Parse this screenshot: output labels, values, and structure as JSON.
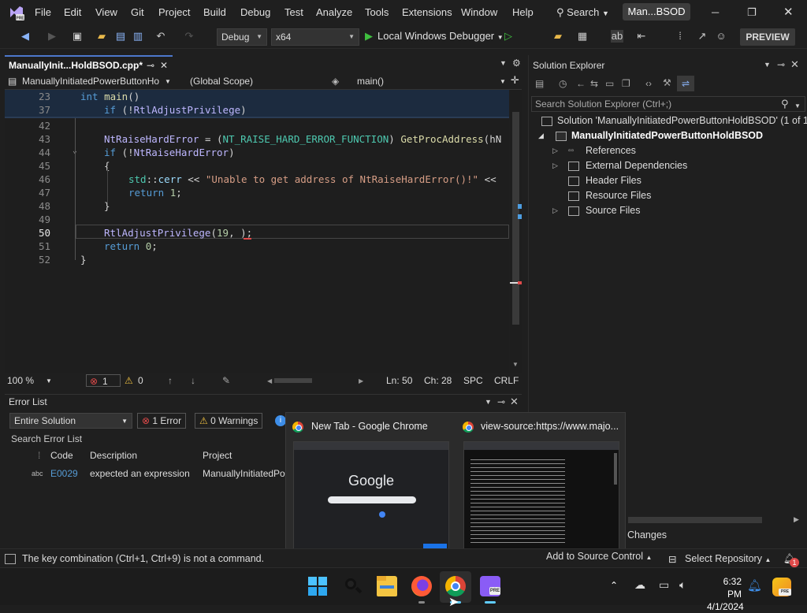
{
  "titlebar": {
    "menus": [
      "File",
      "Edit",
      "View",
      "Git",
      "Project",
      "Build",
      "Debug",
      "Test",
      "Analyze",
      "Tools",
      "Extensions",
      "Window",
      "Help"
    ],
    "search": "Search",
    "project": "Man...BSOD"
  },
  "toolbar": {
    "config": "Debug",
    "platform": "x64",
    "run": "Local Windows Debugger",
    "preview": "PREVIEW"
  },
  "editor": {
    "tab": "ManuallyInit...HoldBSOD.cpp*",
    "nav_file": "ManuallyInitiatedPowerButtonHo",
    "nav_scope": "(Global Scope)",
    "nav_func": "main()",
    "zoom": "100 %",
    "errors": "1",
    "warnings": "0",
    "ln": "Ln: 50",
    "ch": "Ch: 28",
    "spc": "SPC",
    "crlf": "CRLF"
  },
  "code": {
    "lines": [
      {
        "num": "23",
        "text": "int main()"
      },
      {
        "num": "37",
        "text": "if (!RtlAdjustPrivilege)"
      },
      {
        "num": "42",
        "text": ""
      },
      {
        "num": "43",
        "text": "NtRaiseHardError = (NT_RAISE_HARD_ERROR_FUNCTION) GetProcAddress(hN"
      },
      {
        "num": "44",
        "text": "if (!NtRaiseHardError)"
      },
      {
        "num": "45",
        "text": "{"
      },
      {
        "num": "46",
        "text": "std::cerr << \"Unable to get address of NtRaiseHardError()!\" <<"
      },
      {
        "num": "47",
        "text": "return 1;"
      },
      {
        "num": "48",
        "text": "}"
      },
      {
        "num": "49",
        "text": ""
      },
      {
        "num": "50",
        "text": "RtlAdjustPrivilege(19, );"
      },
      {
        "num": "51",
        "text": "return 0;"
      },
      {
        "num": "52",
        "text": "}"
      }
    ]
  },
  "solution_explorer": {
    "title": "Solution Explorer",
    "search_placeholder": "Search Solution Explorer (Ctrl+;)",
    "solution": "Solution 'ManuallyInitiatedPowerButtonHoldBSOD' (1 of 1",
    "project": "ManuallyInitiatedPowerButtonHoldBSOD",
    "items": [
      "References",
      "External Dependencies",
      "Header Files",
      "Resource Files",
      "Source Files"
    ]
  },
  "error_list": {
    "title": "Error List",
    "scope": "Entire Solution",
    "errors_btn": "1 Error",
    "warnings_btn": "0 Warnings",
    "search": "Search Error List",
    "headers": {
      "code": "Code",
      "description": "Description",
      "project": "Project"
    },
    "row": {
      "code": "E0029",
      "description": "expected an expression",
      "project": "ManuallyInitiatedPo"
    }
  },
  "popup": {
    "thumb1_title": "New Tab - Google Chrome",
    "thumb2_title": "view-source:https://www.majo...",
    "google_text": "Google",
    "changes": "Changes"
  },
  "statusbar": {
    "message": "The key combination (Ctrl+1, Ctrl+9) is not a command.",
    "add_source": "Add to Source Control",
    "select_repo": "Select Repository",
    "notif_count": "1"
  },
  "taskbar": {
    "time": "6:32 PM",
    "date": "4/1/2024"
  },
  "colors": {
    "accent": "#4d78cc",
    "error_red": "#e04a4a",
    "warning_yellow": "#f0c040",
    "keyword": "#569cd6",
    "function": "#dcdcaa",
    "string": "#d69d85"
  }
}
